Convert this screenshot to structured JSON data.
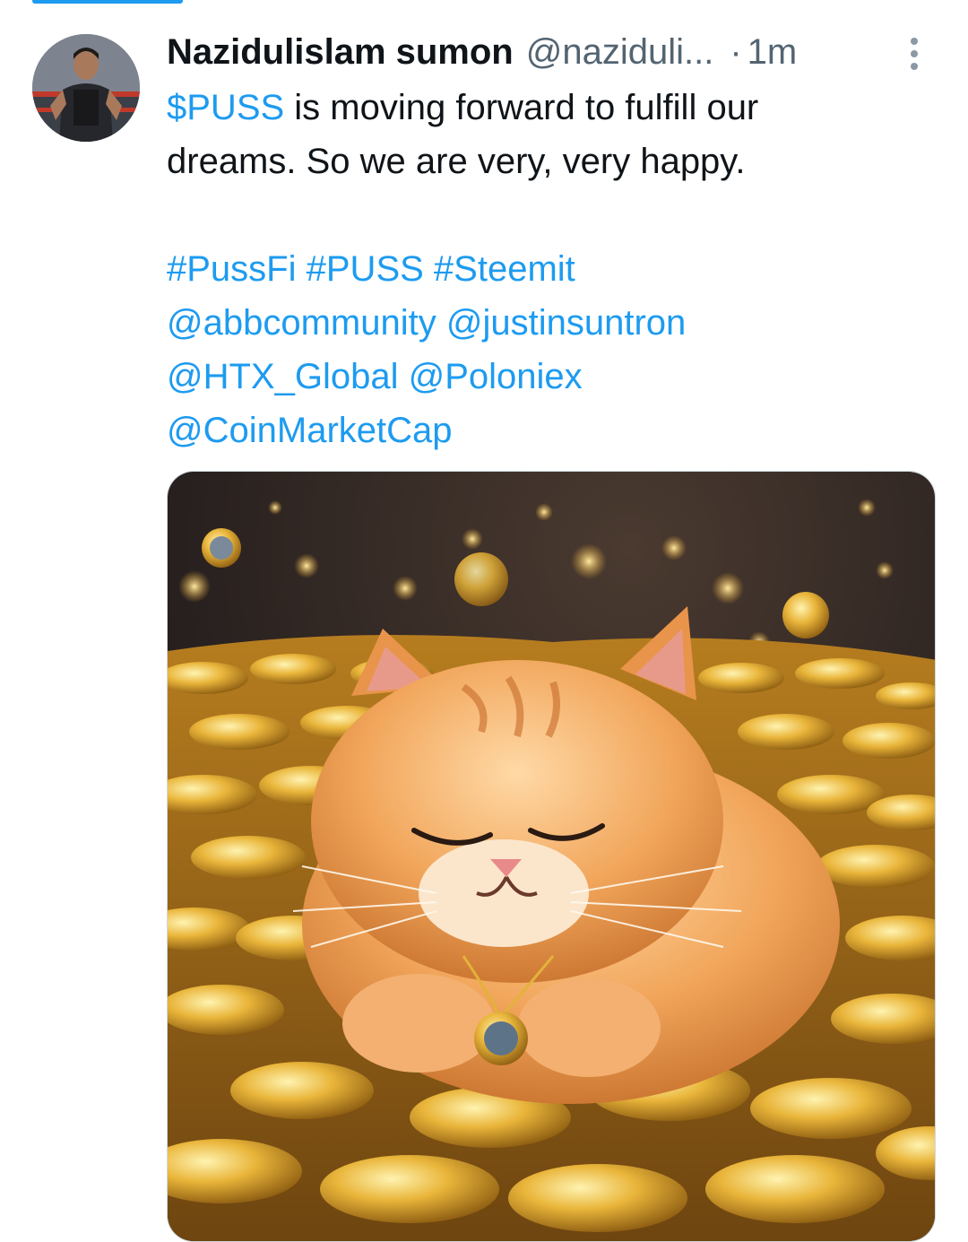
{
  "tweet": {
    "author": {
      "display_name": "Nazidulislam sumon",
      "handle": "@naziduli...",
      "time_separator": "·",
      "time": "1m"
    },
    "text": {
      "cashtag": "$PUSS",
      "line1_rest": " is moving forward to fulfill our",
      "line2": "dreams. So we are very, very happy.",
      "hashtags": [
        "#PussFi",
        "#PUSS",
        "#Steemit"
      ],
      "mentions_line1": [
        "@abbcommunity",
        "@justinsuntron"
      ],
      "mentions_line2": [
        "@HTX_Global",
        "@Poloniex"
      ],
      "mentions_line3": [
        "@CoinMarketCap"
      ]
    },
    "media": {
      "icon": "image-cat-on-gold-coins"
    }
  },
  "colors": {
    "link": "#1d9bf0",
    "text": "#0f1419",
    "secondary": "#536471"
  }
}
